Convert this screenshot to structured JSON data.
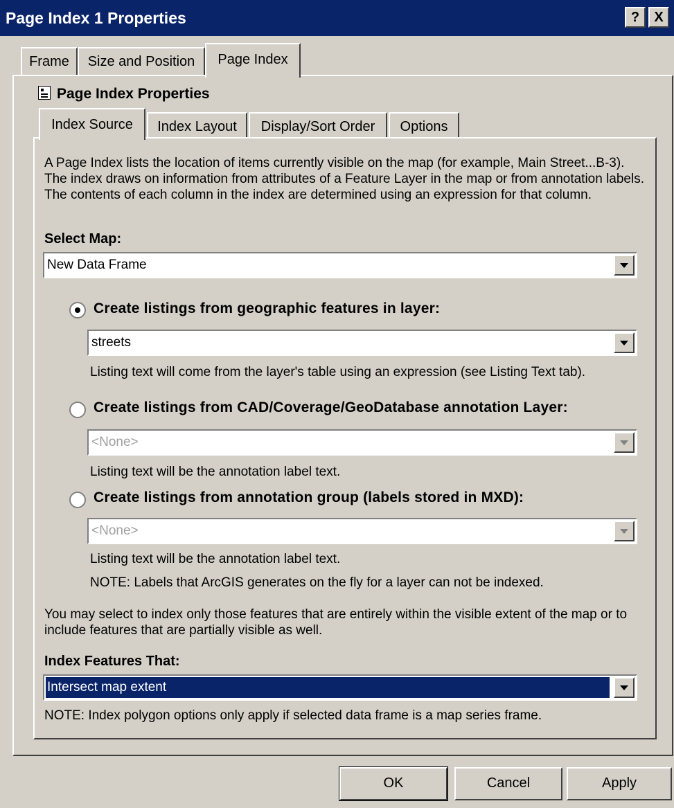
{
  "window": {
    "title": "Page Index 1 Properties",
    "help_button": "?",
    "close_button": "X"
  },
  "outer_tabs": [
    {
      "label": "Frame"
    },
    {
      "label": "Size and Position"
    },
    {
      "label": "Page Index",
      "active": true
    }
  ],
  "page_index": {
    "heading": "Page Index Properties",
    "inner_tabs": [
      {
        "label": "Index Source",
        "active": true
      },
      {
        "label": "Index Layout"
      },
      {
        "label": "Display/Sort Order"
      },
      {
        "label": "Options"
      }
    ],
    "description": "A Page Index lists the location of items currently visible on the map (for example, Main Street...B-3).  The index draws on information from attributes of a Feature Layer in the map or from annotation labels.  The contents of each column in the index are determined using an expression for that column.",
    "select_map_label": "Select Map:",
    "select_map_value": "New Data Frame",
    "option1": {
      "label": "Create listings from geographic features in layer:",
      "checked": true,
      "value": "streets",
      "note": "Listing text will come from the layer's table using an expression (see Listing Text tab)."
    },
    "option2": {
      "label": "Create listings from CAD/Coverage/GeoDatabase annotation Layer:",
      "checked": false,
      "value": "<None>",
      "note": "Listing text will be the annotation label text."
    },
    "option3": {
      "label": "Create listings from annotation group (labels stored in MXD):",
      "checked": false,
      "value": "<None>",
      "note": "Listing text will be the annotation label text.",
      "note2": "NOTE: Labels that ArcGIS generates on the fly for a layer can not be indexed."
    },
    "extent_description": "You may select to index only those features that are entirely within the visible extent of the map or to include features that are partially visible as well.",
    "index_features_label": "Index Features That:",
    "index_features_value": "Intersect map extent",
    "polygon_note": "NOTE: Index polygon options only apply if selected data frame is a map series frame."
  },
  "buttons": {
    "ok": "OK",
    "cancel": "Cancel",
    "apply": "Apply"
  }
}
